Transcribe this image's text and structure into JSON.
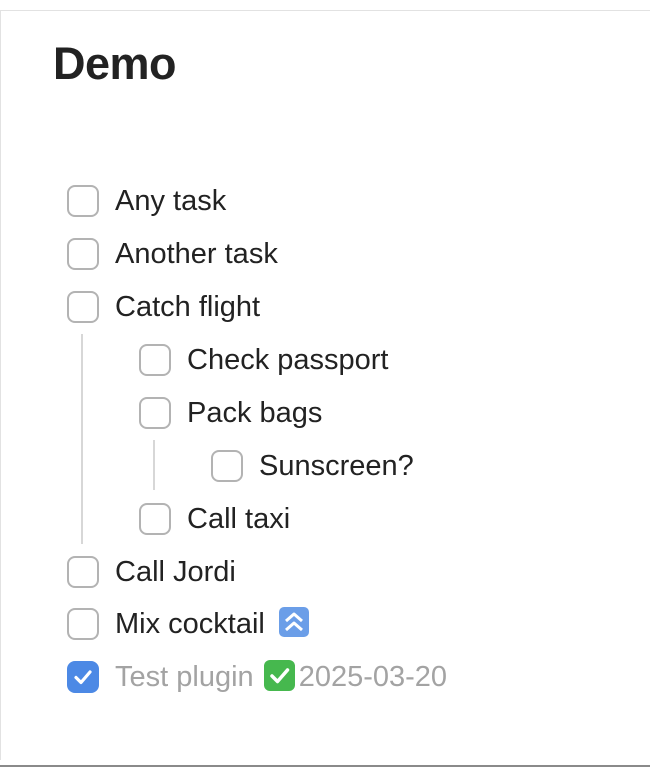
{
  "page": {
    "title": "Demo"
  },
  "tasks": [
    {
      "label": "Any task",
      "checked": false,
      "level": 0
    },
    {
      "label": "Another task",
      "checked": false,
      "level": 0
    },
    {
      "label": "Catch flight",
      "checked": false,
      "level": 0
    },
    {
      "label": "Check passport",
      "checked": false,
      "level": 1
    },
    {
      "label": "Pack bags",
      "checked": false,
      "level": 1
    },
    {
      "label": "Sunscreen?",
      "checked": false,
      "level": 2
    },
    {
      "label": "Call taxi",
      "checked": false,
      "level": 1
    },
    {
      "label": "Call Jordi",
      "checked": false,
      "level": 0
    },
    {
      "label": "Mix cocktail",
      "checked": false,
      "level": 0,
      "priority_icon": "high-priority-up-arrows-icon"
    },
    {
      "label": "Test plugin",
      "checked": true,
      "level": 0,
      "status_icon": "done-check-mark-icon",
      "done_date": "2025-03-20"
    }
  ],
  "colors": {
    "text": "#222222",
    "completed_text": "#a3a3a3",
    "checkbox_border": "#b3b3b3",
    "checkbox_checked": "#4c89e5",
    "indent_guide": "#d7d7d7"
  }
}
